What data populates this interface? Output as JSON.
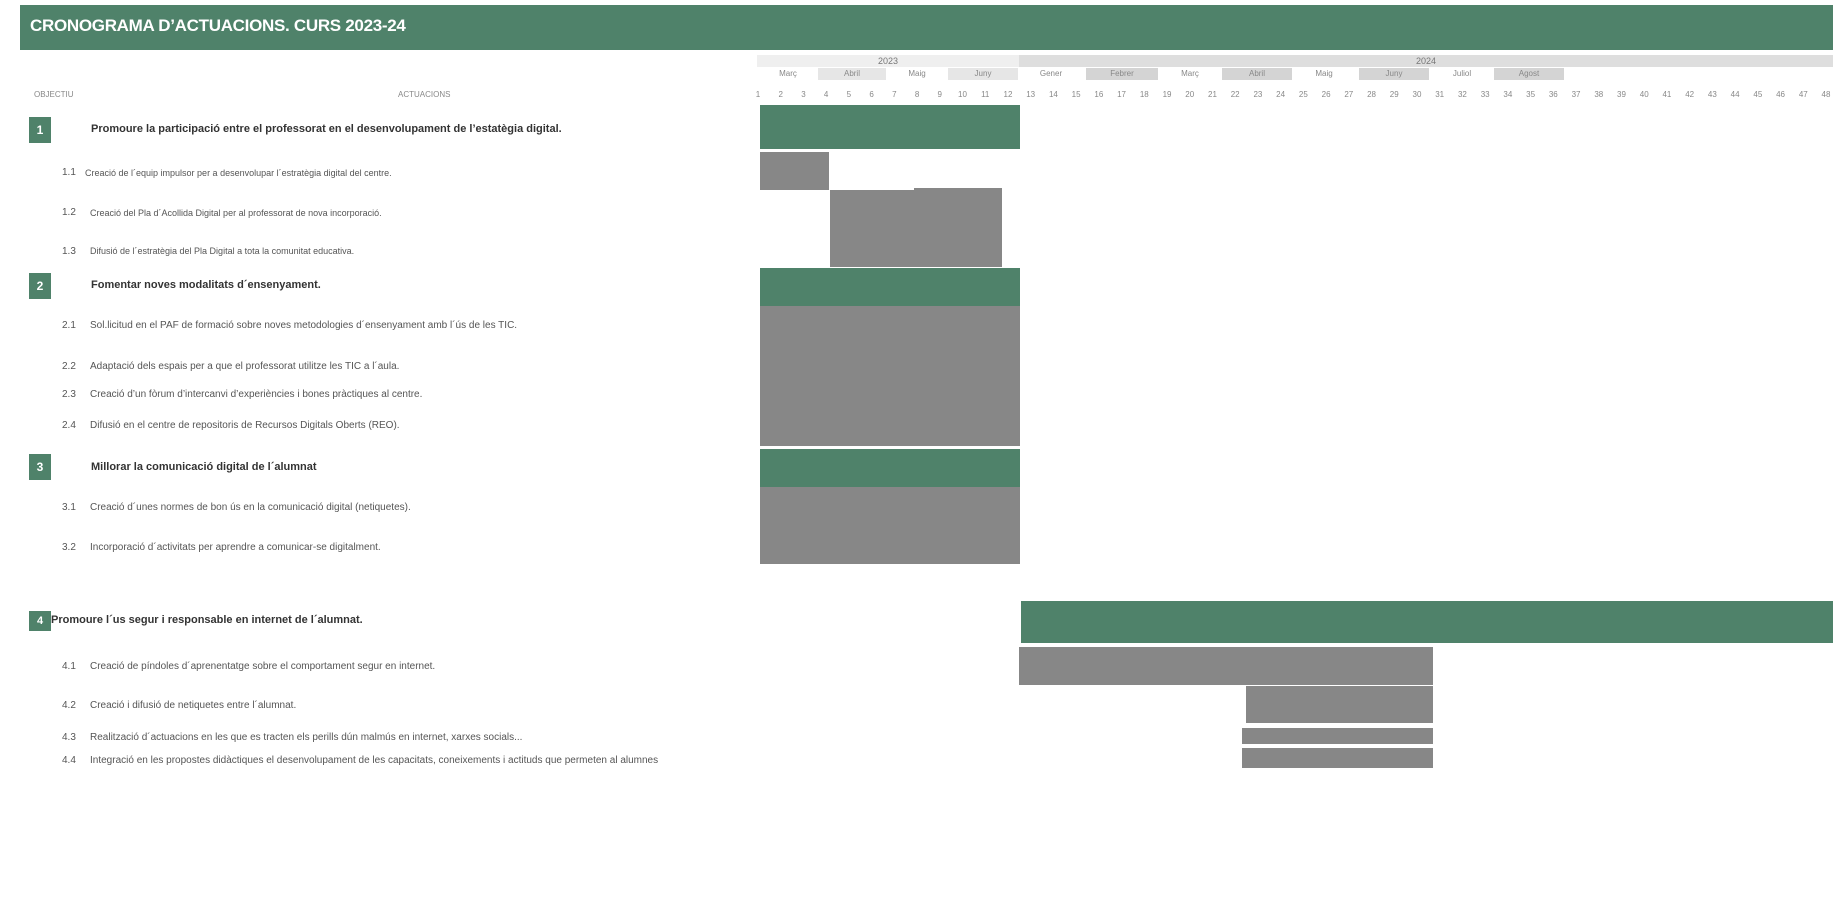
{
  "title": "CRONOGRAMA D’ACTUACIONS. CURS 2023-24",
  "colors": {
    "accent": "#4f826a",
    "activity_bar": "#878787",
    "month_shade": "#d4d4d4",
    "year2_shade": "#dedede"
  },
  "header": {
    "col_objectiu": "OBJECTIU",
    "col_actuacions": "ACTUACIONS",
    "years": [
      "2023",
      "2024"
    ],
    "months_2023": [
      "Març",
      "Abril",
      "Maig",
      "Juny"
    ],
    "months_2024": [
      "Gener",
      "Febrer",
      "Març",
      "Abril",
      "Maig",
      "Juny",
      "Juliol",
      "Agost"
    ],
    "weeks": [
      "1",
      "2",
      "3",
      "4",
      "5",
      "6",
      "7",
      "8",
      "9",
      "10",
      "11",
      "12",
      "13",
      "14",
      "15",
      "16",
      "17",
      "18",
      "19",
      "20",
      "21",
      "22",
      "23",
      "24",
      "25",
      "26",
      "27",
      "28",
      "29",
      "30",
      "31",
      "32",
      "33",
      "34",
      "35",
      "36",
      "37",
      "38",
      "39",
      "40",
      "41",
      "42",
      "43",
      "44",
      "45",
      "46",
      "47",
      "48"
    ]
  },
  "objectives": [
    {
      "num": "1",
      "title": "Promoure la participació entre el professorat  en el desenvolupament de l’estatègia digital.",
      "actions": [
        {
          "num": "1.1",
          "text": "Creació de l´equip impulsor per a desenvolupar l´estratègia digital del centre."
        },
        {
          "num": "1.2",
          "text": "Creació del Pla d´Acollida Digital per al professorat de nova incorporació."
        },
        {
          "num": "1.3",
          "text": "Difusió de l´estratègia del Pla Digital a tota la comunitat educativa."
        }
      ]
    },
    {
      "num": "2",
      "title": "Fomentar noves modalitats d´ensenyament.",
      "actions": [
        {
          "num": "2.1",
          "text": "Sol.licitud en el PAF de formació sobre noves metodologies d´ensenyament amb l´ús de les TIC."
        },
        {
          "num": "2.2",
          "text": "Adaptació dels espais per a que el professorat utilitze les TIC a l´aula."
        },
        {
          "num": "2.3",
          "text": "Creació d’un fòrum d’intercanvi d’experiències i bones pràctiques al centre."
        },
        {
          "num": "2.4",
          "text": "Difusió en el centre de repositoris de Recursos Digitals Oberts (REO)."
        }
      ]
    },
    {
      "num": "3",
      "title": "Millorar la comunicació digital de l´alumnat",
      "actions": [
        {
          "num": "3.1",
          "text": "Creació d´unes normes de bon ús en la comunicació digital (netiquetes)."
        },
        {
          "num": "3.2",
          "text": "Incorporació d´activitats per aprendre a comunicar-se digitalment."
        }
      ]
    },
    {
      "num": "4",
      "title": "Promoure l´us segur i responsable en internet de l´alumnat.",
      "actions": [
        {
          "num": "4.1",
          "text": "Creació de píndoles d´aprenentatge sobre el comportament segur en internet."
        },
        {
          "num": "4.2",
          "text": "Creació i difusió de netiquetes entre l´alumnat."
        },
        {
          "num": "4.3",
          "text": "Realització d´actuacions en les que es tracten els perills dún malmús en internet, xarxes socials..."
        },
        {
          "num": "4.4",
          "text": "Integració en les propostes didàctiques el desenvolupament de les capacitats, coneixements i actituds que permeten al alumnes"
        }
      ]
    }
  ]
}
